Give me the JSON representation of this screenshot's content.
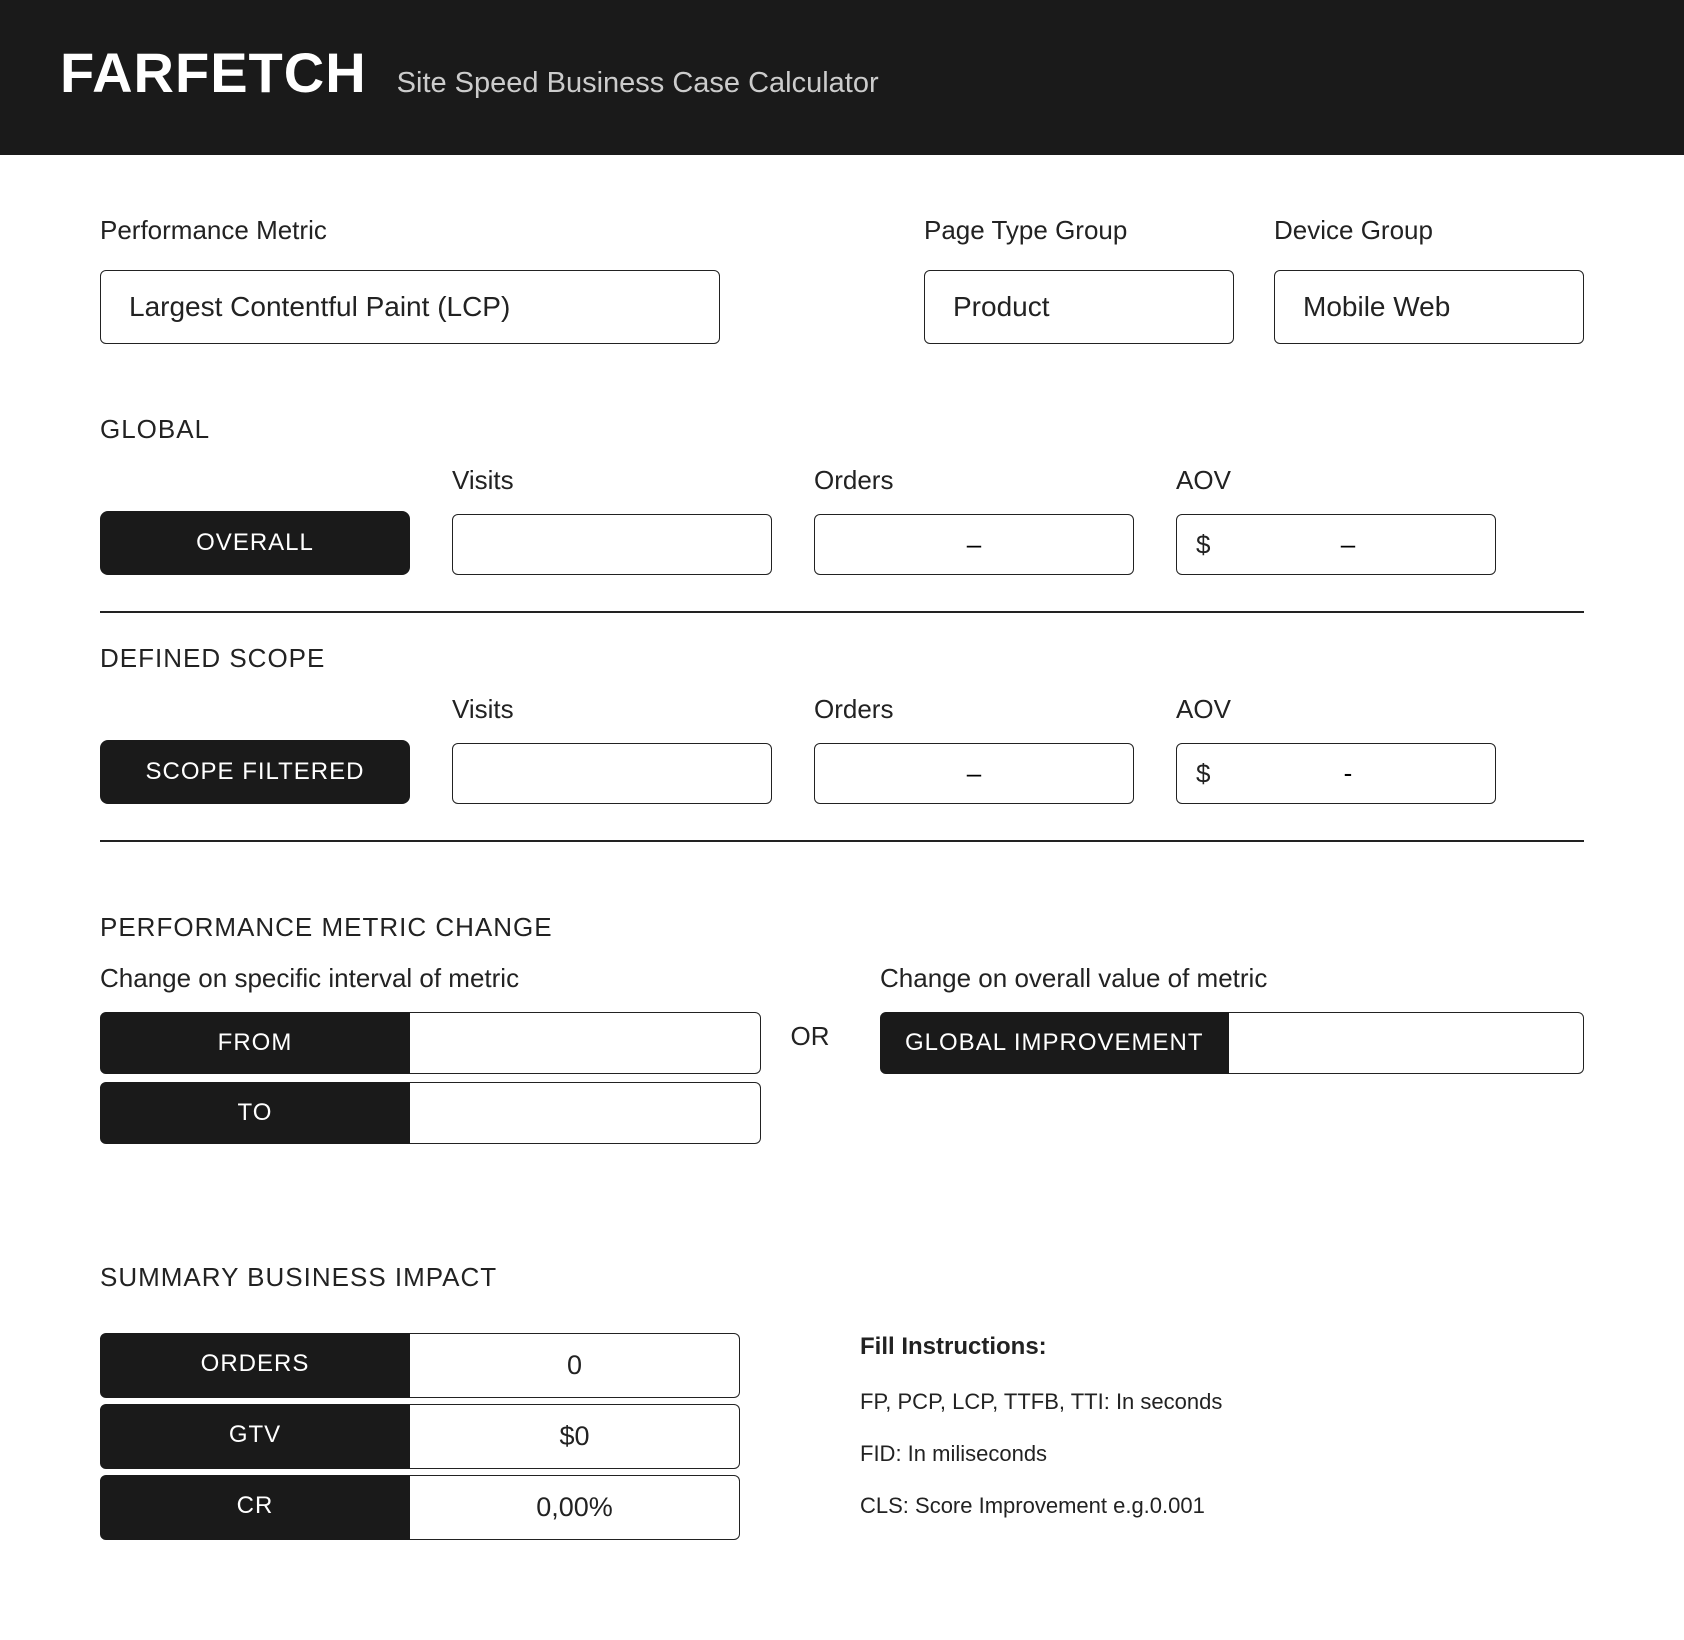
{
  "header": {
    "logo": "FARFETCH",
    "subtitle": "Site Speed Business Case Calculator"
  },
  "filters": {
    "metric_label": "Performance Metric",
    "metric_value": "Largest Contentful Paint (LCP)",
    "page_type_label": "Page Type Group",
    "page_type_value": "Product",
    "device_label": "Device Group",
    "device_value": "Mobile Web"
  },
  "global": {
    "section_label": "GLOBAL",
    "overall_label": "OVERALL",
    "visits_label": "Visits",
    "visits_value": "",
    "orders_label": "Orders",
    "orders_value": "–",
    "aov_label": "AOV",
    "aov_currency": "$",
    "aov_value": "–"
  },
  "scope": {
    "section_label": "DEFINED SCOPE",
    "filtered_label": "SCOPE FILTERED",
    "visits_label": "Visits",
    "visits_value": "",
    "orders_label": "Orders",
    "orders_value": "–",
    "aov_label": "AOV",
    "aov_currency": "$",
    "aov_value": "-"
  },
  "change": {
    "section_label": "PERFORMANCE METRIC CHANGE",
    "interval_sublabel": "Change on specific interval of metric",
    "overall_sublabel": "Change on overall value of metric",
    "from_label": "FROM",
    "from_value": "",
    "to_label": "TO",
    "to_value": "",
    "or_label": "OR",
    "global_improvement_label": "GLOBAL IMPROVEMENT",
    "global_improvement_value": ""
  },
  "summary": {
    "section_label": "SUMMARY BUSINESS IMPACT",
    "orders_label": "ORDERS",
    "orders_value": "0",
    "gtv_label": "GTV",
    "gtv_value": "$0",
    "cr_label": "CR",
    "cr_value": "0,00%"
  },
  "instructions": {
    "title": "Fill Instructions:",
    "line1": "FP, PCP, LCP, TTFB, TTI: In seconds",
    "line2": "FID: In miliseconds",
    "line3": "CLS: Score Improvement e.g.0.001"
  }
}
